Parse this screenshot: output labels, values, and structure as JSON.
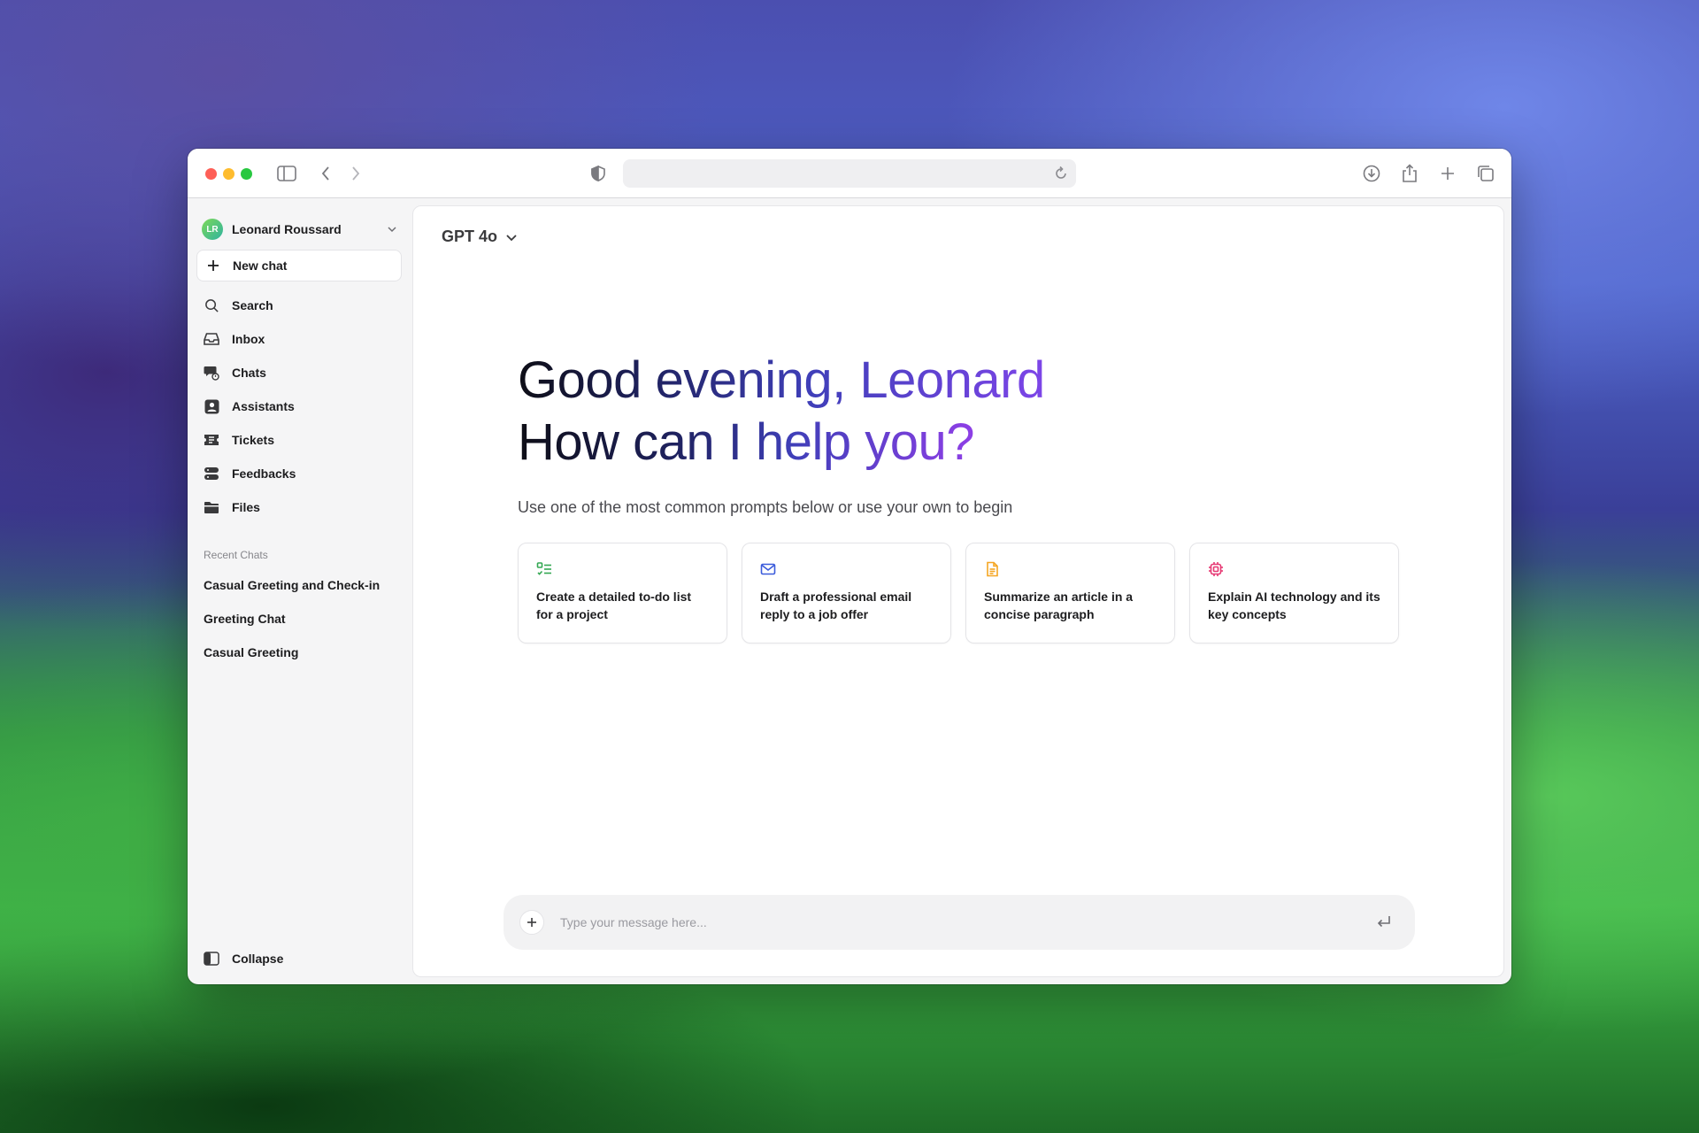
{
  "user": {
    "initials": "LR",
    "name": "Leonard Roussard"
  },
  "sidebar": {
    "new_chat": "New chat",
    "items": [
      {
        "label": "Search",
        "icon": "search-icon"
      },
      {
        "label": "Inbox",
        "icon": "inbox-icon"
      },
      {
        "label": "Chats",
        "icon": "chats-icon"
      },
      {
        "label": "Assistants",
        "icon": "assistants-icon"
      },
      {
        "label": "Tickets",
        "icon": "ticket-icon"
      },
      {
        "label": "Feedbacks",
        "icon": "feedback-icon"
      },
      {
        "label": "Files",
        "icon": "folder-icon"
      }
    ],
    "recent_title": "Recent Chats",
    "recent": [
      "Casual Greeting and Check-in",
      "Greeting Chat",
      "Casual Greeting"
    ],
    "collapse": "Collapse"
  },
  "main": {
    "model": "GPT 4o",
    "greeting_line1": "Good evening, Leonard",
    "greeting_line2": "How can I help you?",
    "subtitle": "Use one of the most common prompts below or use your own to begin",
    "cards": [
      {
        "text": "Create a detailed to-do list for a project",
        "icon": "checklist-icon",
        "color": "#34a853"
      },
      {
        "text": "Draft a professional email reply to a job offer",
        "icon": "mail-icon",
        "color": "#3b5bdb"
      },
      {
        "text": "Summarize an article in a concise paragraph",
        "icon": "document-icon",
        "color": "#f5a623"
      },
      {
        "text": "Explain AI technology and its key concepts",
        "icon": "chip-icon",
        "color": "#e63973"
      }
    ],
    "composer_placeholder": "Type your message here..."
  },
  "colors": {
    "traffic_red": "#fe5f57",
    "traffic_yellow": "#febc2e",
    "traffic_green": "#28c840",
    "greeting_gradient_end": "#7d45e8"
  }
}
